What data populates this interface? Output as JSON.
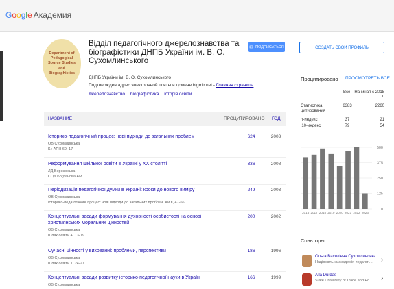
{
  "header": {
    "logo_google": [
      "G",
      "o",
      "o",
      "g",
      "l",
      "e"
    ],
    "logo_rest": "Академия"
  },
  "profile": {
    "avatar_text": "Department of Pedagogical Source Studies and Biographistics",
    "name": "Відділ педагогічного джерелознавства та біографістики ДНПБ України ім. В. О. Сухомлинського",
    "affiliation": "ДНПБ України ім. В. О. Сухомлинського",
    "email_text": "Подтвержден адрес электронной почты в домене bigmir.net - ",
    "homepage_label": "Главная страница",
    "tags": [
      "джерелознавство",
      "біографістика",
      "історія освіти"
    ]
  },
  "buttons": {
    "follow": "ПОДПИСАТЬСЯ",
    "create_profile": "СОЗДАТЬ СВОЙ ПРОФИЛЬ"
  },
  "table": {
    "col_title": "НАЗВАНИЕ",
    "col_cited": "ПРОЦИТИРОВАНО",
    "col_year": "ГОД",
    "rows": [
      {
        "title": "Історико-педагогічний процес: нові підходи до загальних проблем",
        "authors": "ОВ Сухомлинська",
        "venue": "К.: АПН 69, 17",
        "cited": "624",
        "year": "2003"
      },
      {
        "title": "Реформування шкільної освіти в Україні у ХХ столітті",
        "authors": "ЛД Березівська",
        "venue": "СПД Богданова АМ",
        "cited": "336",
        "year": "2008"
      },
      {
        "title": "Періодизація педагогічної думки в Україні: кроки до нового виміру",
        "authors": "ОВ Сухомлинська",
        "venue": "Історико-педагогічний процес: нові підходи до загальних проблем. Київ, 47-66",
        "cited": "249",
        "year": "2003"
      },
      {
        "title": "Концептуальні засади формування духовності особистості на основі християнських моральних цінностей",
        "authors": "ОВ Сухомлинська",
        "venue": "Шлях освіти 4, 13-19",
        "cited": "200",
        "year": "2002"
      },
      {
        "title": "Сучасні цінності у вихованні: проблеми, перспективи",
        "authors": "ОВ Сухомлинська",
        "venue": "Шлях освіти 1, 24-27",
        "cited": "186",
        "year": "1996"
      },
      {
        "title": "Концептуальні засади розвитку історико-педагогічної науки в Україні",
        "authors": "ОВ Сухомлинська",
        "venue": "",
        "cited": "166",
        "year": "1999"
      }
    ]
  },
  "cited_panel": {
    "heading": "Процитировано",
    "view_all": "ПРОСМОТРЕТЬ ВСЕ",
    "col_all": "Все",
    "col_since": "Начиная с 2018 г.",
    "rows": [
      {
        "label": "Статистика цитирования",
        "all": "6383",
        "since": "2260"
      },
      {
        "label": "h-индекс",
        "all": "37",
        "since": "21"
      },
      {
        "label": "i10-индекс",
        "all": "79",
        "since": "54"
      }
    ]
  },
  "chart_data": {
    "type": "bar",
    "categories": [
      "2016",
      "2017",
      "2018",
      "2019",
      "2020",
      "2021",
      "2022",
      "2023"
    ],
    "values": [
      420,
      440,
      490,
      445,
      345,
      470,
      500,
      125
    ],
    "ylim": [
      0,
      500
    ],
    "yticks": [
      "500",
      "375",
      "250",
      "125",
      "0"
    ],
    "bar_color": "#777777"
  },
  "coauthors": {
    "heading": "Соавторы",
    "items": [
      {
        "name": "Ольга Василівна Сухомлинська",
        "affiliation": "Національна академія педагогі...",
        "avatar_color": "#c08a5a"
      },
      {
        "name": "Alla Durdas",
        "affiliation": "State University of Trade and Ec...",
        "avatar_color": "#b83a2a"
      }
    ]
  }
}
